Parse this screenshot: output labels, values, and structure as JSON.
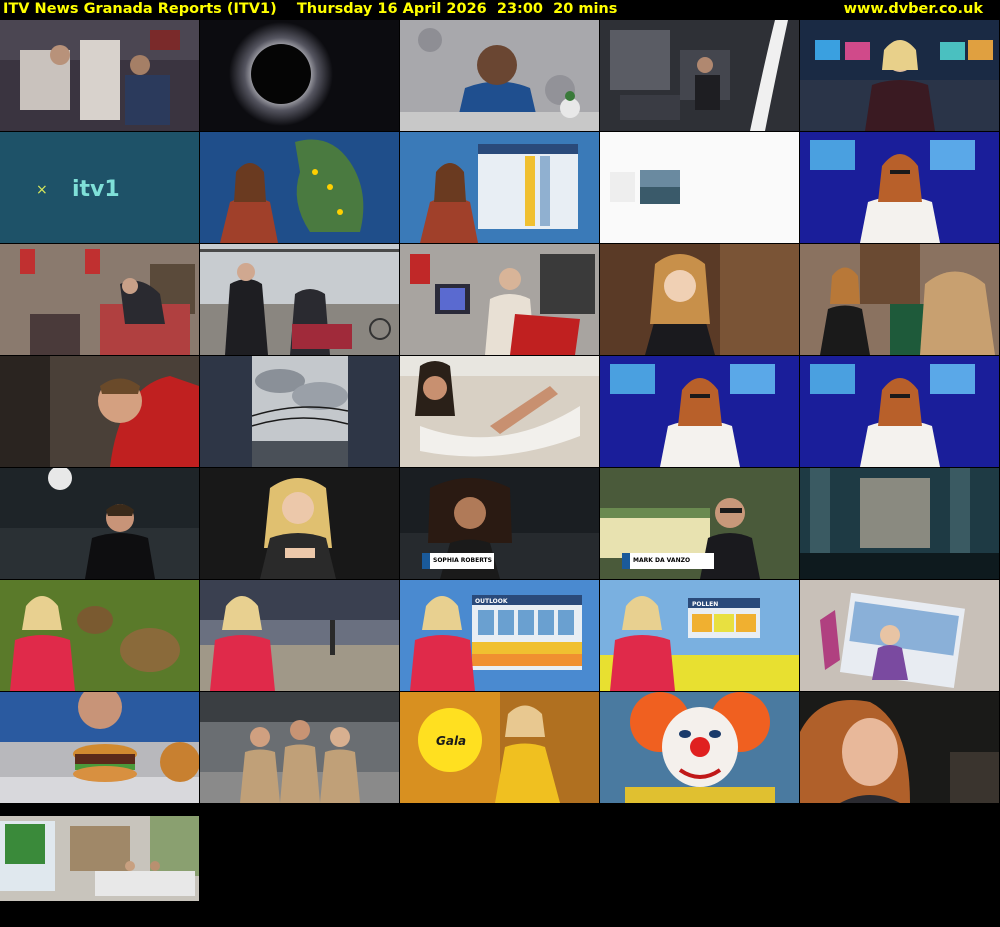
{
  "header": {
    "title": "ITV News Granada Reports (ITV1)    Thursday 16 April 2026  23:00  20 mins",
    "site": "www.dvber.co.uk"
  },
  "colors": {
    "header_text": "#ffff00",
    "background": "#000000"
  },
  "thumbnails": [
    {
      "label": "",
      "scene": "space-station-crew"
    },
    {
      "label": "",
      "scene": "solar-eclipse"
    },
    {
      "label": "",
      "scene": "astronaut-interview"
    },
    {
      "label": "",
      "scene": "space-station-interior"
    },
    {
      "label": "",
      "scene": "newsroom-presenter"
    },
    {
      "label": "",
      "scene": "itv1-logo"
    },
    {
      "label": "",
      "scene": "weather-map-presenter"
    },
    {
      "label": "",
      "scene": "weather-outlook-presenter"
    },
    {
      "label": "",
      "scene": "white-screen"
    },
    {
      "label": "",
      "scene": "studio-presenter"
    },
    {
      "label": "",
      "scene": "bedroom-man-wheelchair"
    },
    {
      "label": "",
      "scene": "seaside-promenade"
    },
    {
      "label": "",
      "scene": "family-living-room"
    },
    {
      "label": "",
      "scene": "young-woman-interview"
    },
    {
      "label": "",
      "scene": "two-women-sofa"
    },
    {
      "label": "",
      "scene": "man-reclining"
    },
    {
      "label": "",
      "scene": "cloudy-sky-wires"
    },
    {
      "label": "",
      "scene": "woman-hammock"
    },
    {
      "label": "",
      "scene": "studio-presenter"
    },
    {
      "label": "",
      "scene": "studio-presenter"
    },
    {
      "label": "",
      "scene": "man-theatre-seats"
    },
    {
      "label": "",
      "scene": "blonde-woman-portrait"
    },
    {
      "label": "SOPHIA ROBERTS",
      "scene": "woman-theatre-interview"
    },
    {
      "label": "MARK DA VANZO",
      "scene": "man-glasses-interview"
    },
    {
      "label": "",
      "scene": "theatre-interior"
    },
    {
      "label": "",
      "scene": "weather-ducklings"
    },
    {
      "label": "",
      "scene": "weather-beach-statue"
    },
    {
      "label": "OUTLOOK",
      "scene": "weather-outlook-chart"
    },
    {
      "label": "POLLEN",
      "scene": "weather-pollen-chart"
    },
    {
      "label": "",
      "scene": "girl-beach-photo"
    },
    {
      "label": "",
      "scene": "burger-advert"
    },
    {
      "label": "",
      "scene": "showroom-staff"
    },
    {
      "label": "Gala",
      "scene": "gala-advert"
    },
    {
      "label": "",
      "scene": "clown-face"
    },
    {
      "label": "",
      "scene": "woman-closeup"
    },
    {
      "label": "",
      "scene": "living-room-tv"
    }
  ]
}
